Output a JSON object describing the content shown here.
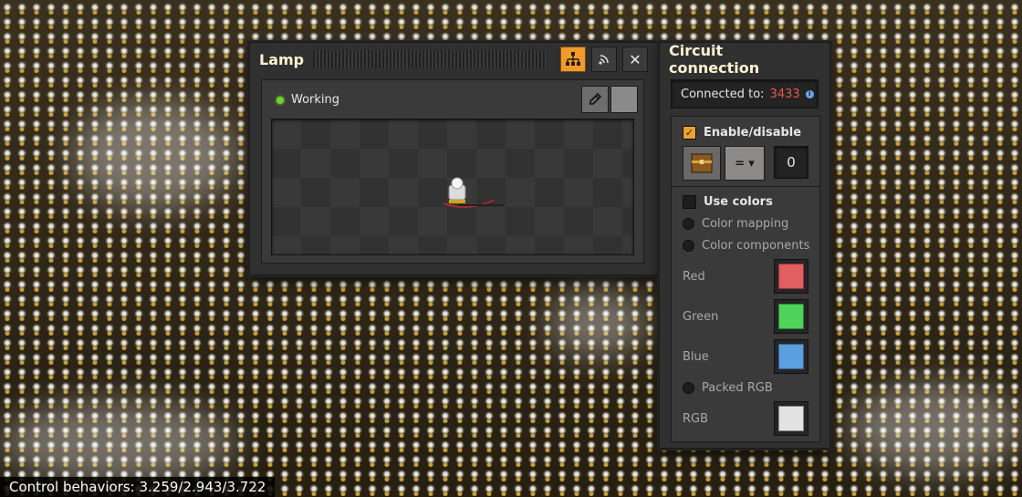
{
  "lamp_window": {
    "title": "Lamp",
    "status": "Working",
    "close_glyph": "✕",
    "icons": [
      "circuit-network-icon",
      "wireless-icon",
      "close-icon",
      "eyedropper-icon"
    ]
  },
  "circuit_window": {
    "title": "Circuit connection",
    "connected_label": "Connected to:",
    "connected_id": "3433",
    "info_glyph": "i",
    "enable_disable": {
      "label": "Enable/disable",
      "checked": true,
      "operator": "=",
      "operator_caret": "▾",
      "value": "0"
    },
    "use_colors": {
      "label": "Use colors",
      "checked": false
    },
    "color_mode_options": [
      "Color mapping",
      "Color components"
    ],
    "channels": [
      {
        "label": "Red",
        "color": "#e15e61"
      },
      {
        "label": "Green",
        "color": "#4fd35a"
      },
      {
        "label": "Blue",
        "color": "#5a9fe0"
      }
    ],
    "packed_label": "Packed RGB",
    "rgb": {
      "label": "RGB",
      "color": "#e2e2e2"
    }
  },
  "statusbar": {
    "text": "Control behaviors: 3.259/2.943/3.722"
  },
  "colors": {
    "accent": "#f09a2c",
    "connected_id": "#e85a4f",
    "status_green": "#6bd32b"
  }
}
